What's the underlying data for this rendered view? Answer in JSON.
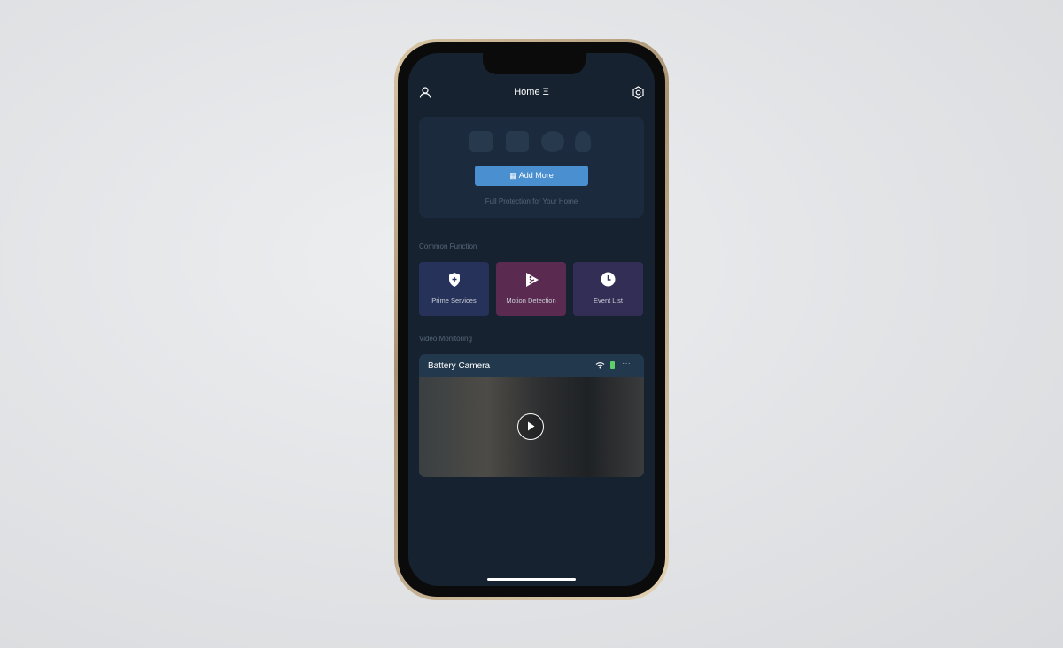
{
  "header": {
    "title": "Home",
    "menu_glyph": "Ξ"
  },
  "banner": {
    "add_label": "Add More",
    "subtitle": "Full Protection for Your Home",
    "devices": [
      "tv-icon",
      "hub-icon",
      "camera-icon",
      "bulb-icon"
    ]
  },
  "common": {
    "title": "Common Function",
    "tiles": [
      {
        "label": "Prime Services",
        "color": "#26325a",
        "icon": "shield-plus-icon"
      },
      {
        "label": "Motion Detection",
        "color": "#5b2a50",
        "icon": "motion-icon"
      },
      {
        "label": "Event List",
        "color": "#322e55",
        "icon": "clock-icon"
      }
    ]
  },
  "video": {
    "title": "Video Monitoring",
    "camera": {
      "name": "Battery Camera",
      "more": "···"
    }
  }
}
